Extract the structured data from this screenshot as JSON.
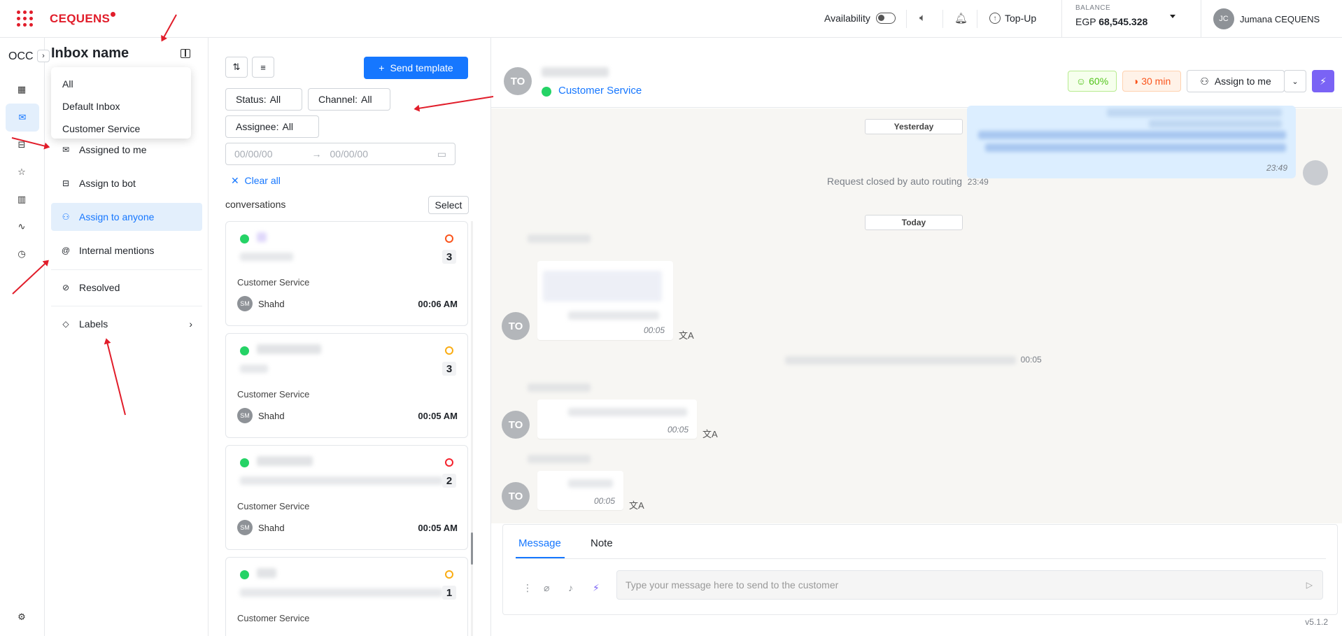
{
  "topbar": {
    "brand": "CEQUENS",
    "availability_label": "Availability",
    "topup_label": "Top-Up",
    "balance_label": "BALANCE",
    "balance_currency": "EGP",
    "balance_value": "68,545.328",
    "user_initials": "JC",
    "user_name": "Jumana CEQUENS"
  },
  "rail": {
    "label": "OCC"
  },
  "inbox": {
    "title": "Inbox name",
    "dropdown": [
      "All",
      "Default Inbox",
      "Customer Service"
    ],
    "nav": [
      {
        "label": "Assigned to me"
      },
      {
        "label": "Assign to bot"
      },
      {
        "label": "Assign to anyone"
      },
      {
        "label": "Internal mentions"
      },
      {
        "label": "Resolved"
      },
      {
        "label": "Labels"
      }
    ]
  },
  "list": {
    "send_template": "Send template",
    "status_label": "Status:",
    "status_value": "All",
    "channel_label": "Channel:",
    "channel_value": "All",
    "assignee_label": "Assignee:",
    "assignee_value": "All",
    "date_from": "00/00/00",
    "date_to": "00/00/00",
    "clear_all": "Clear all",
    "header": "conversations",
    "select": "Select",
    "cards": [
      {
        "service": "Customer Service",
        "agent_initials": "SM",
        "agent": "Shahd",
        "time": "00:06 AM",
        "count": "3",
        "status_color": "#fa541c"
      },
      {
        "service": "Customer Service",
        "agent_initials": "SM",
        "agent": "Shahd",
        "time": "00:05 AM",
        "count": "3",
        "status_color": "#faad14"
      },
      {
        "service": "Customer Service",
        "agent_initials": "SM",
        "agent": "Shahd",
        "time": "00:05 AM",
        "count": "2",
        "status_color": "#f5222d"
      },
      {
        "service": "Customer Service",
        "agent_initials": "",
        "agent": "",
        "time": "",
        "count": "1",
        "status_color": "#faad14"
      }
    ]
  },
  "chat": {
    "contact_initials": "TO",
    "channel_name": "Customer Service",
    "score": "60%",
    "sla": "30 min",
    "assign_to_me": "Assign to me",
    "day_yesterday": "Yesterday",
    "day_today": "Today",
    "outgoing_time": "23:49",
    "system_msg": "Request closed by auto routing",
    "system_time": "23:49",
    "msg_times": [
      "00:05",
      "00:05",
      "00:05"
    ],
    "system2_time": "00:05",
    "tab_message": "Message",
    "tab_note": "Note",
    "input_placeholder": "Type your message here to send to the customer",
    "version": "v5.1.2"
  },
  "colors": {
    "brand": "#e11d2a",
    "accent": "#1677ff",
    "bolt": "#7a63f5"
  }
}
